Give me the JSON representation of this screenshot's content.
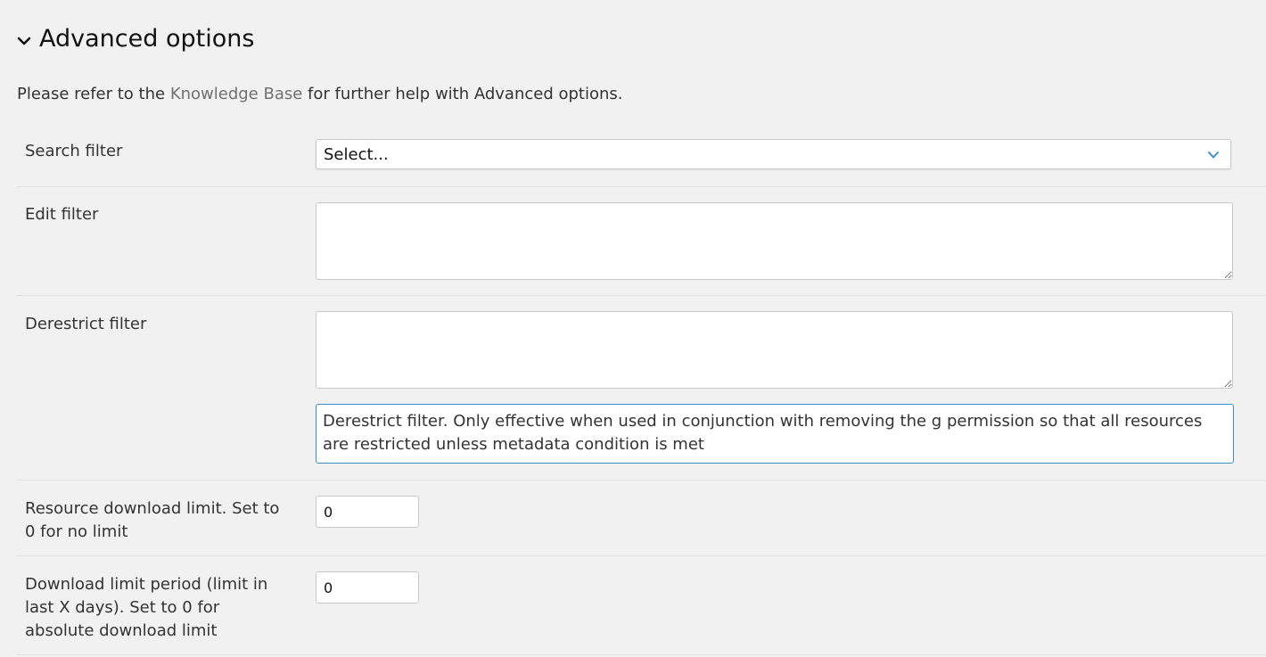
{
  "section": {
    "title": "Advanced options",
    "icon": "chevron-down-icon"
  },
  "help": {
    "prefix": "Please refer to the ",
    "link": "Knowledge Base",
    "suffix": " for further help with Advanced options."
  },
  "fields": {
    "search_filter": {
      "label": "Search filter",
      "value": "Select..."
    },
    "edit_filter": {
      "label": "Edit filter",
      "value": ""
    },
    "derestrict_filter": {
      "label": "Derestrict filter",
      "value": "",
      "help": "Derestrict filter. Only effective when used in conjunction with removing the g permission so that all resources are restricted unless metadata condition is met"
    },
    "download_limit": {
      "label": "Resource download limit. Set to 0 for no limit",
      "value": "0"
    },
    "download_period": {
      "label": "Download limit period (limit in last X days). Set to 0 for absolute download limit",
      "value": "0"
    }
  },
  "colors": {
    "accent": "#3b8fc8",
    "link": "#707070",
    "background": "#f1f1f1"
  }
}
